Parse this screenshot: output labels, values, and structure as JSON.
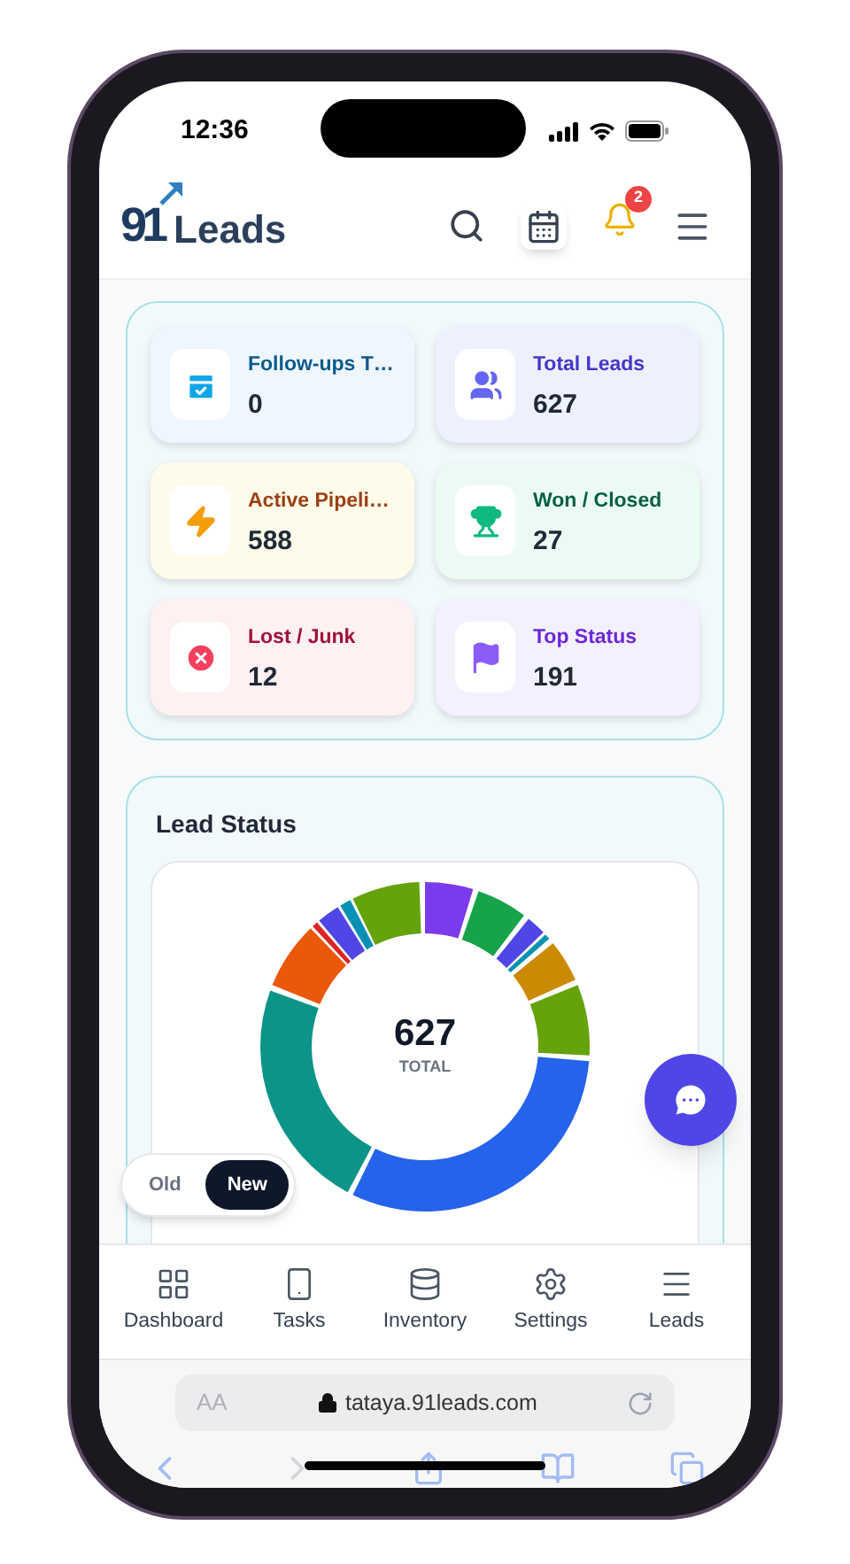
{
  "status_bar": {
    "time": "12:36"
  },
  "header": {
    "logo": {
      "mark": "91",
      "name": "Leads"
    },
    "notifications": {
      "count": "2"
    }
  },
  "stats": [
    {
      "kind": "calendar",
      "label": "Follow-ups T…",
      "value": "0",
      "color": "#0ea5e9"
    },
    {
      "kind": "users",
      "label": "Total Leads",
      "value": "627",
      "color": "#6366f1"
    },
    {
      "kind": "zap",
      "label": "Active Pipeli…",
      "value": "588",
      "color": "#f59e0b"
    },
    {
      "kind": "trophy",
      "label": "Won / Closed",
      "value": "27",
      "color": "#10b981"
    },
    {
      "kind": "lost",
      "label": "Lost / Junk",
      "value": "12",
      "color": "#f43f5e"
    },
    {
      "kind": "flag",
      "label": "Top Status",
      "value": "191",
      "color": "#8b5cf6"
    }
  ],
  "lead_status": {
    "title": "Lead Status",
    "total": "627",
    "total_label": "TOTAL"
  },
  "version_toggle": [
    {
      "label": "Old",
      "selected": false
    },
    {
      "label": "New",
      "selected": true
    }
  ],
  "bottom_nav": [
    {
      "kind": "grid",
      "label": "Dashboard"
    },
    {
      "kind": "phone",
      "label": "Tasks"
    },
    {
      "kind": "database",
      "label": "Inventory"
    },
    {
      "kind": "settings",
      "label": "Settings"
    },
    {
      "kind": "menu",
      "label": "Leads"
    }
  ],
  "browser": {
    "text_size": "AA",
    "url": "tataya.91leads.com"
  }
}
